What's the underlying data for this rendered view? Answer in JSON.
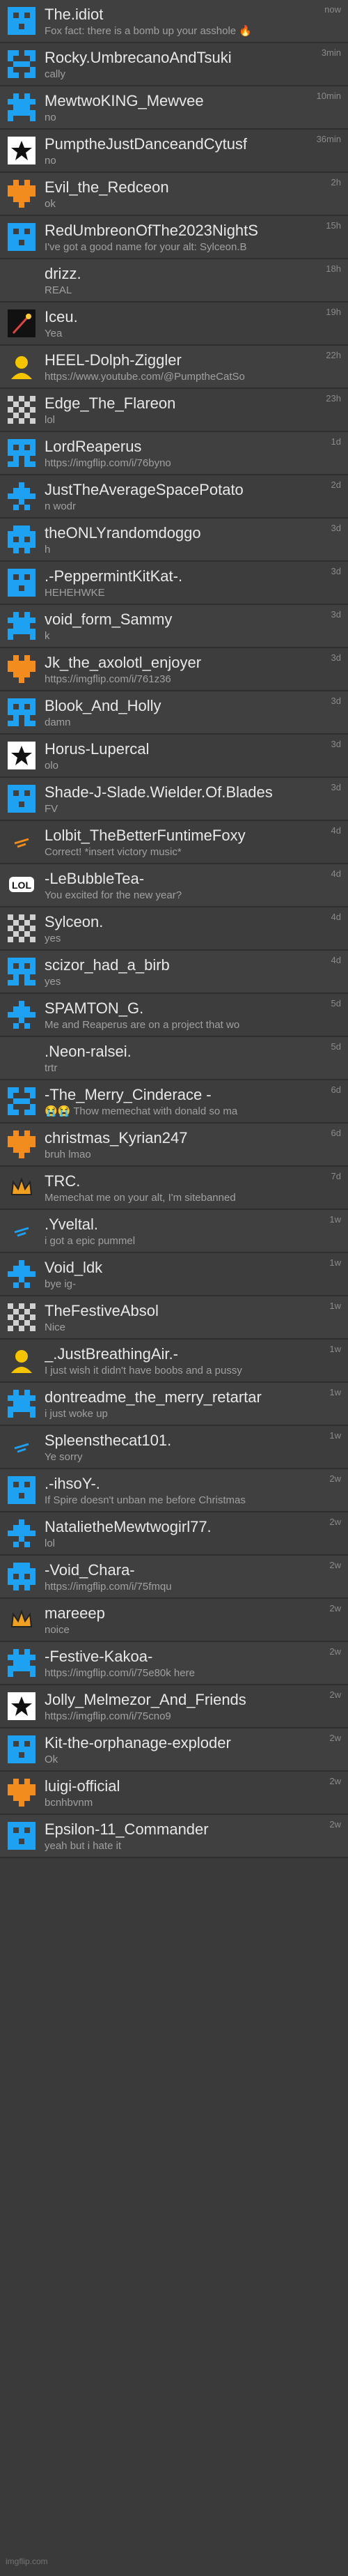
{
  "accent": "#1ea1f2",
  "rows": [
    {
      "name": "The.idiot",
      "msg": "Fox fact: there is a bomb up your asshole 🔥",
      "time": "now",
      "icon": "pixel-robot-icon"
    },
    {
      "name": "Rocky.UmbrecanoAndTsuki",
      "msg": "cally",
      "time": "3min",
      "icon": "pixel-shape-icon"
    },
    {
      "name": "MewtwoKING_Mewvee",
      "msg": "no",
      "time": "10min",
      "icon": "pixel-shape-icon"
    },
    {
      "name": "PumptheJustDanceandCytusf",
      "msg": "no",
      "time": "36min",
      "icon": "star-badge-icon"
    },
    {
      "name": "Evil_the_Redceon",
      "msg": "ok",
      "time": "2h",
      "icon": "orange-pixel-icon"
    },
    {
      "name": "RedUmbreonOfThe2023NightS",
      "msg": "I've got a good name for your alt: Sylceon.B",
      "time": "15h",
      "icon": "pixel-robot-icon"
    },
    {
      "name": "drizz.",
      "msg": "REAL",
      "time": "18h",
      "icon": "blank-avatar-icon"
    },
    {
      "name": "Iceu.",
      "msg": "Yea",
      "time": "19h",
      "icon": "wand-icon"
    },
    {
      "name": "HEEL-Dolph-Ziggler",
      "msg": "https://www.youtube.com/@PumptheCatSo",
      "time": "22h",
      "icon": "person-avatar-icon"
    },
    {
      "name": "Edge_The_Flareon",
      "msg": "lol",
      "time": "23h",
      "icon": "checker-icon"
    },
    {
      "name": "LordReaperus",
      "msg": "https://imgflip.com/i/76byno",
      "time": "1d",
      "icon": "pixel-shape-icon"
    },
    {
      "name": "JustTheAverageSpacePotato",
      "msg": "n wodr",
      "time": "2d",
      "icon": "pixel-shape-icon"
    },
    {
      "name": "theONLYrandomdoggo",
      "msg": "h",
      "time": "3d",
      "icon": "pixel-shape-icon"
    },
    {
      "name": ".-PeppermintKitKat-.",
      "msg": "HEHEHWKE",
      "time": "3d",
      "icon": "pixel-robot-icon"
    },
    {
      "name": "void_form_Sammy",
      "msg": "k",
      "time": "3d",
      "icon": "pixel-shape-icon"
    },
    {
      "name": "Jk_the_axolotl_enjoyer",
      "msg": "https://imgflip.com/i/761z36",
      "time": "3d",
      "icon": "orange-pixel-icon"
    },
    {
      "name": "Blook_And_Holly",
      "msg": "damn",
      "time": "3d",
      "icon": "pixel-shape-icon"
    },
    {
      "name": "Horus-Lupercal",
      "msg": "olo",
      "time": "3d",
      "icon": "star-badge-icon"
    },
    {
      "name": "Shade-J-Slade.Wielder.Of.Blades",
      "msg": "FV",
      "time": "3d",
      "icon": "pixel-robot-icon"
    },
    {
      "name": "Lolbit_TheBetterFuntimeFoxy",
      "msg": "Correct! *insert victory music*",
      "time": "4d",
      "icon": "orange-dash-icon"
    },
    {
      "name": "-LeBubbleTea-",
      "msg": "You excited for the new year?",
      "time": "4d",
      "icon": "lol-badge-icon"
    },
    {
      "name": "Sylceon.",
      "msg": "yes",
      "time": "4d",
      "icon": "checker-icon"
    },
    {
      "name": "scizor_had_a_birb",
      "msg": "yes",
      "time": "4d",
      "icon": "pixel-shape-icon"
    },
    {
      "name": "SPAMTON_G.",
      "msg": "Me and Reaperus are on a project that wo",
      "time": "5d",
      "icon": "pixel-shape-icon"
    },
    {
      "name": ".Neon-ralsei.",
      "msg": "trtr",
      "time": "5d",
      "icon": "blank-avatar-icon"
    },
    {
      "name": "-The_Merry_Cinderace -",
      "msg": "😭😭 Thow memechat with donald so ma",
      "time": "6d",
      "icon": "pixel-shape-icon"
    },
    {
      "name": "christmas_Kyrian247",
      "msg": "bruh lmao",
      "time": "6d",
      "icon": "orange-pixel-icon"
    },
    {
      "name": "TRC.",
      "msg": "Memechat me on your alt, I'm sitebanned",
      "time": "7d",
      "icon": "crown-icon"
    },
    {
      "name": ".Yveltal.",
      "msg": "i got a epic pummel",
      "time": "1w",
      "icon": "blue-dash-icon"
    },
    {
      "name": "Void_ldk",
      "msg": "bye ig-",
      "time": "1w",
      "icon": "pixel-shape-icon"
    },
    {
      "name": "TheFestiveAbsol",
      "msg": "Nice",
      "time": "1w",
      "icon": "checker-icon"
    },
    {
      "name": "_.JustBreathingAir.-",
      "msg": "I just wish it didn't have boobs and a pussy",
      "time": "1w",
      "icon": "person-avatar-icon"
    },
    {
      "name": "dontreadme_the_merry_retartar",
      "msg": "i just woke up",
      "time": "1w",
      "icon": "pixel-shape-icon"
    },
    {
      "name": "Spleensthecat101.",
      "msg": "Ye sorry",
      "time": "1w",
      "icon": "blue-dash-icon"
    },
    {
      "name": ".-ihsoY-.",
      "msg": "If Spire doesn't unban me before Christmas",
      "time": "2w",
      "icon": "pixel-robot-icon"
    },
    {
      "name": "NatalietheMewtwogirl77.",
      "msg": "lol",
      "time": "2w",
      "icon": "pixel-shape-icon"
    },
    {
      "name": "-Void_Chara-",
      "msg": "https://imgflip.com/i/75fmqu",
      "time": "2w",
      "icon": "pixel-shape-icon"
    },
    {
      "name": "mareeep",
      "msg": "noice",
      "time": "2w",
      "icon": "crown-icon"
    },
    {
      "name": "-Festive-Kakoa-",
      "msg": "https://imgflip.com/i/75e80k here",
      "time": "2w",
      "icon": "pixel-shape-icon"
    },
    {
      "name": "Jolly_Melmezor_And_Friends",
      "msg": "https://imgflip.com/i/75cno9",
      "time": "2w",
      "icon": "star-badge-icon"
    },
    {
      "name": "Kit-the-orphanage-exploder",
      "msg": "Ok",
      "time": "2w",
      "icon": "pixel-robot-icon"
    },
    {
      "name": "luigi-official",
      "msg": "bcnhbvnm",
      "time": "2w",
      "icon": "orange-pixel-icon"
    },
    {
      "name": "Epsilon-11_Commander",
      "msg": "yeah but i hate it",
      "time": "2w",
      "icon": "pixel-robot-icon"
    }
  ],
  "footer": "imgflip.com"
}
